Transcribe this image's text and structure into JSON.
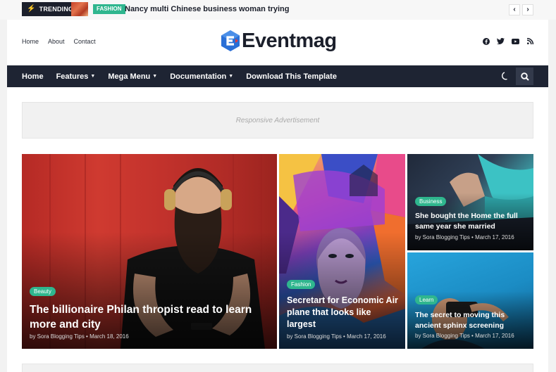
{
  "trending": {
    "label": "TRENDING",
    "category": "FASHION",
    "title": "Nancy multi Chinese business woman trying",
    "prev_icon": "‹",
    "next_icon": "›"
  },
  "header": {
    "links": [
      "Home",
      "About",
      "Contact"
    ],
    "logo_text": "Eventmag",
    "social_icons": [
      "facebook-icon",
      "twitter-icon",
      "youtube-icon",
      "rss-icon"
    ]
  },
  "nav": {
    "items": [
      {
        "label": "Home",
        "dropdown": false
      },
      {
        "label": "Features",
        "dropdown": true
      },
      {
        "label": "Mega Menu",
        "dropdown": true
      },
      {
        "label": "Documentation",
        "dropdown": true
      },
      {
        "label": "Download This Template",
        "dropdown": false
      }
    ],
    "chevron": "⌄"
  },
  "ad": {
    "text": "Responsive Advertisement"
  },
  "featured": [
    {
      "category": "Beauty",
      "title": "The billionaire Philan thropist read to learn more and city",
      "meta": "by Sora Blogging Tips • March 18, 2016"
    },
    {
      "category": "Fashion",
      "title": "Secretart for Economic Air plane that looks like largest",
      "meta": "by Sora Blogging Tips • March 17, 2016"
    },
    {
      "category": "Business",
      "title": "She bought the Home the full same year she married",
      "meta": "by Sora Blogging Tips • March 17, 2016"
    },
    {
      "category": "Learn",
      "title": "The secret to moving this ancient sphinx screening",
      "meta": "by Sora Blogging Tips • March 17, 2016"
    }
  ],
  "colors": {
    "accent": "#2fb68e",
    "nav_bg": "#1e2433",
    "dark": "#1b1f2b"
  }
}
